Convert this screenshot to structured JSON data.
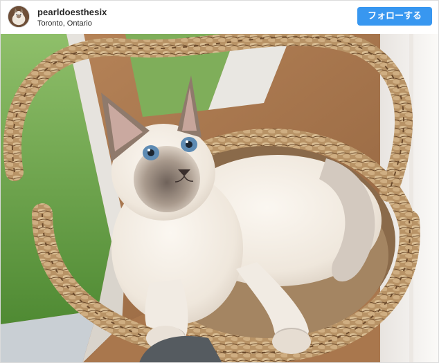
{
  "post": {
    "username": "pearldoesthesix",
    "location": "Toronto, Ontario",
    "follow_label": "フォローする"
  },
  "colors": {
    "follow_button": "#3897f0",
    "text": "#262626",
    "border": "#dbdbdb"
  },
  "icons": {
    "avatar": "profile-photo"
  }
}
